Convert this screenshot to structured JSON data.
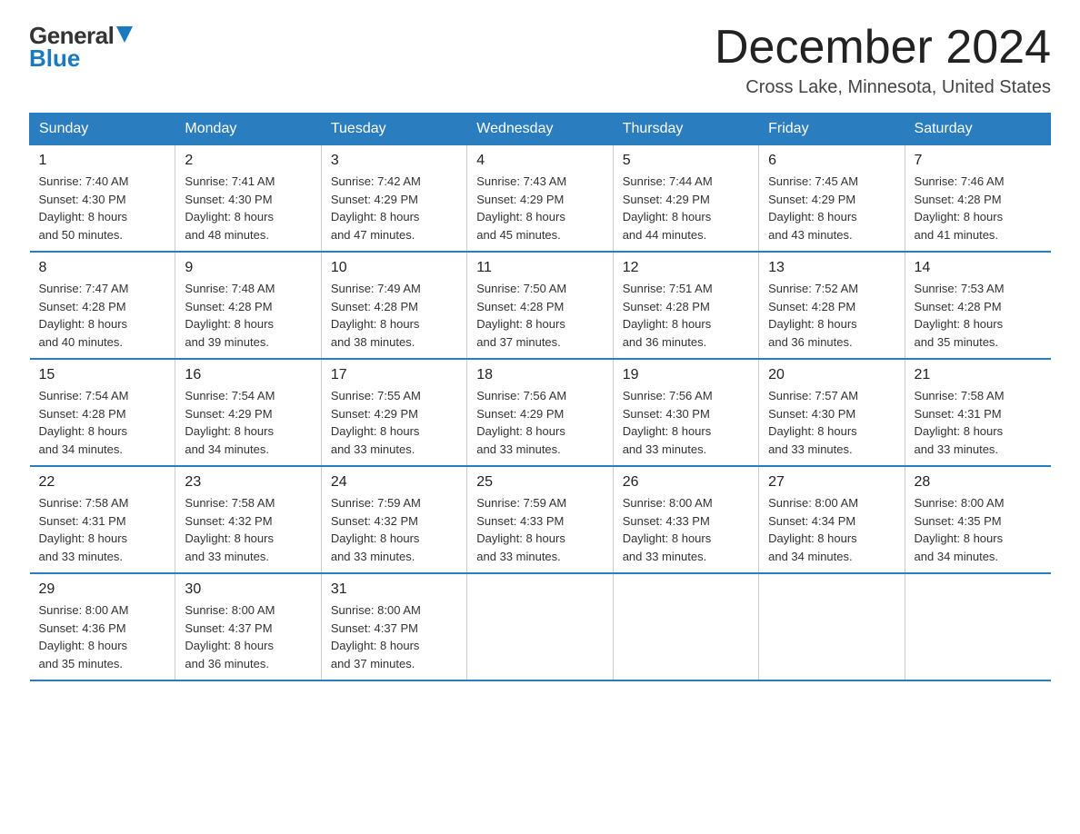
{
  "header": {
    "logo_text": "General",
    "logo_blue": "Blue",
    "month": "December 2024",
    "location": "Cross Lake, Minnesota, United States"
  },
  "weekdays": [
    "Sunday",
    "Monday",
    "Tuesday",
    "Wednesday",
    "Thursday",
    "Friday",
    "Saturday"
  ],
  "weeks": [
    [
      {
        "day": "1",
        "sunrise": "7:40 AM",
        "sunset": "4:30 PM",
        "daylight": "8 hours and 50 minutes."
      },
      {
        "day": "2",
        "sunrise": "7:41 AM",
        "sunset": "4:30 PM",
        "daylight": "8 hours and 48 minutes."
      },
      {
        "day": "3",
        "sunrise": "7:42 AM",
        "sunset": "4:29 PM",
        "daylight": "8 hours and 47 minutes."
      },
      {
        "day": "4",
        "sunrise": "7:43 AM",
        "sunset": "4:29 PM",
        "daylight": "8 hours and 45 minutes."
      },
      {
        "day": "5",
        "sunrise": "7:44 AM",
        "sunset": "4:29 PM",
        "daylight": "8 hours and 44 minutes."
      },
      {
        "day": "6",
        "sunrise": "7:45 AM",
        "sunset": "4:29 PM",
        "daylight": "8 hours and 43 minutes."
      },
      {
        "day": "7",
        "sunrise": "7:46 AM",
        "sunset": "4:28 PM",
        "daylight": "8 hours and 41 minutes."
      }
    ],
    [
      {
        "day": "8",
        "sunrise": "7:47 AM",
        "sunset": "4:28 PM",
        "daylight": "8 hours and 40 minutes."
      },
      {
        "day": "9",
        "sunrise": "7:48 AM",
        "sunset": "4:28 PM",
        "daylight": "8 hours and 39 minutes."
      },
      {
        "day": "10",
        "sunrise": "7:49 AM",
        "sunset": "4:28 PM",
        "daylight": "8 hours and 38 minutes."
      },
      {
        "day": "11",
        "sunrise": "7:50 AM",
        "sunset": "4:28 PM",
        "daylight": "8 hours and 37 minutes."
      },
      {
        "day": "12",
        "sunrise": "7:51 AM",
        "sunset": "4:28 PM",
        "daylight": "8 hours and 36 minutes."
      },
      {
        "day": "13",
        "sunrise": "7:52 AM",
        "sunset": "4:28 PM",
        "daylight": "8 hours and 36 minutes."
      },
      {
        "day": "14",
        "sunrise": "7:53 AM",
        "sunset": "4:28 PM",
        "daylight": "8 hours and 35 minutes."
      }
    ],
    [
      {
        "day": "15",
        "sunrise": "7:54 AM",
        "sunset": "4:28 PM",
        "daylight": "8 hours and 34 minutes."
      },
      {
        "day": "16",
        "sunrise": "7:54 AM",
        "sunset": "4:29 PM",
        "daylight": "8 hours and 34 minutes."
      },
      {
        "day": "17",
        "sunrise": "7:55 AM",
        "sunset": "4:29 PM",
        "daylight": "8 hours and 33 minutes."
      },
      {
        "day": "18",
        "sunrise": "7:56 AM",
        "sunset": "4:29 PM",
        "daylight": "8 hours and 33 minutes."
      },
      {
        "day": "19",
        "sunrise": "7:56 AM",
        "sunset": "4:30 PM",
        "daylight": "8 hours and 33 minutes."
      },
      {
        "day": "20",
        "sunrise": "7:57 AM",
        "sunset": "4:30 PM",
        "daylight": "8 hours and 33 minutes."
      },
      {
        "day": "21",
        "sunrise": "7:58 AM",
        "sunset": "4:31 PM",
        "daylight": "8 hours and 33 minutes."
      }
    ],
    [
      {
        "day": "22",
        "sunrise": "7:58 AM",
        "sunset": "4:31 PM",
        "daylight": "8 hours and 33 minutes."
      },
      {
        "day": "23",
        "sunrise": "7:58 AM",
        "sunset": "4:32 PM",
        "daylight": "8 hours and 33 minutes."
      },
      {
        "day": "24",
        "sunrise": "7:59 AM",
        "sunset": "4:32 PM",
        "daylight": "8 hours and 33 minutes."
      },
      {
        "day": "25",
        "sunrise": "7:59 AM",
        "sunset": "4:33 PM",
        "daylight": "8 hours and 33 minutes."
      },
      {
        "day": "26",
        "sunrise": "8:00 AM",
        "sunset": "4:33 PM",
        "daylight": "8 hours and 33 minutes."
      },
      {
        "day": "27",
        "sunrise": "8:00 AM",
        "sunset": "4:34 PM",
        "daylight": "8 hours and 34 minutes."
      },
      {
        "day": "28",
        "sunrise": "8:00 AM",
        "sunset": "4:35 PM",
        "daylight": "8 hours and 34 minutes."
      }
    ],
    [
      {
        "day": "29",
        "sunrise": "8:00 AM",
        "sunset": "4:36 PM",
        "daylight": "8 hours and 35 minutes."
      },
      {
        "day": "30",
        "sunrise": "8:00 AM",
        "sunset": "4:37 PM",
        "daylight": "8 hours and 36 minutes."
      },
      {
        "day": "31",
        "sunrise": "8:00 AM",
        "sunset": "4:37 PM",
        "daylight": "8 hours and 37 minutes."
      },
      null,
      null,
      null,
      null
    ]
  ],
  "labels": {
    "sunrise": "Sunrise:",
    "sunset": "Sunset:",
    "daylight": "Daylight:"
  }
}
